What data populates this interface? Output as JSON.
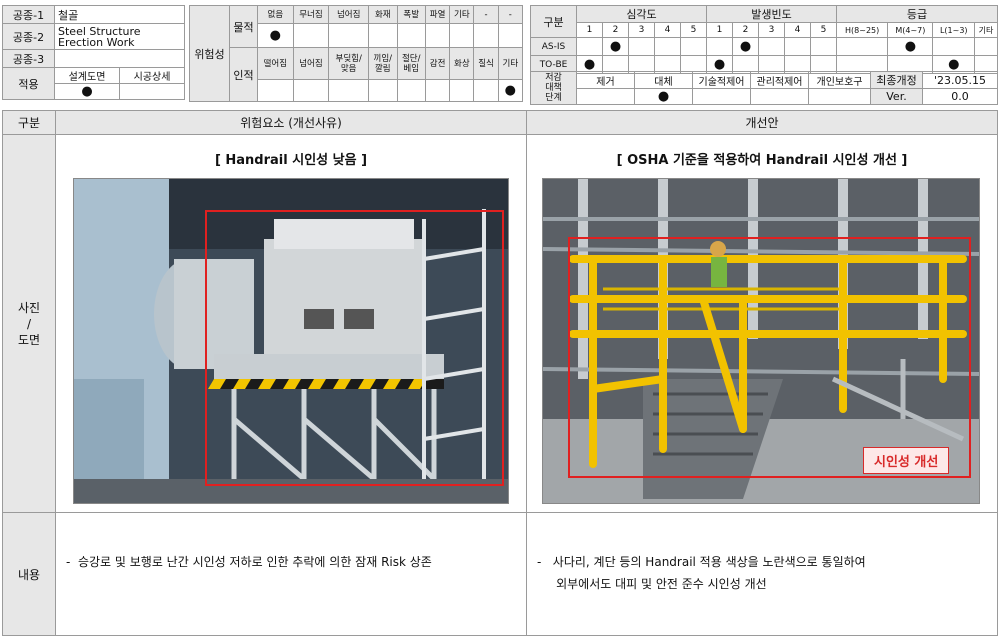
{
  "header_left": {
    "rows": [
      {
        "label": "공종-1",
        "value": "철골"
      },
      {
        "label": "공종-2",
        "value": "Steel Structure\nErection Work"
      },
      {
        "label": "공종-3",
        "value": ""
      }
    ],
    "apply": {
      "label": "적용",
      "drawing": "설계도면",
      "detail": "시공상세",
      "dot": "●"
    }
  },
  "risk": {
    "label": "위험성",
    "material": {
      "label": "물적",
      "items": [
        "없음",
        "무너짐",
        "넘어짐",
        "화재",
        "폭발",
        "파열",
        "기타",
        "-",
        "-"
      ],
      "dot": "●"
    },
    "human": {
      "label": "인적",
      "items": [
        "떨어짐",
        "넘어짐",
        "부딪힘/\n맞음",
        "끼임/\n깔림",
        "절단/\n베임",
        "감전",
        "화상",
        "질식",
        "기타"
      ],
      "dot": "●"
    }
  },
  "assessment": {
    "section_label": "구분",
    "severity": {
      "label": "심각도",
      "nums": [
        "1",
        "2",
        "3",
        "4",
        "5"
      ]
    },
    "frequency": {
      "label": "발생빈도",
      "nums": [
        "1",
        "2",
        "3",
        "4",
        "5"
      ]
    },
    "grade": {
      "label": "등급",
      "levels": [
        "H(8~25)",
        "M(4~7)",
        "L(1~3)",
        "기타"
      ]
    },
    "asis": {
      "label": "AS-IS",
      "dot": "●"
    },
    "tobe": {
      "label": "TO-BE",
      "dot": "●"
    }
  },
  "reduction": {
    "label": "저감\n대책\n단계",
    "items": [
      "제거",
      "대체",
      "기술적제어",
      "관리적제어",
      "개인보호구"
    ],
    "dot": "●",
    "revision_label": "최종개정",
    "revision_value": "'23.05.15",
    "ver_label": "Ver.",
    "ver_value": "0.0"
  },
  "main": {
    "section_label": "구분",
    "left_header": "위험요소 (개선사유)",
    "right_header": "개선안",
    "photo_label": "사진\n/\n도면",
    "left_caption": "[ Handrail 시인성 낮음 ]",
    "right_caption": "[ OSHA 기준을 적용하여 Handrail 시인성 개선 ]",
    "badge": "시인성 개선",
    "content_label": "내용",
    "left_content": "-  승강로 및 보행로 난간 시인성 저하로 인한 추락에 의한 잠재 Risk 상존",
    "right_content": "-   사다리, 계단 등의 Handrail 적용 색상을 노란색으로 통일하여\n     외부에서도 대피 및 안전 준수 시인성 개선"
  }
}
